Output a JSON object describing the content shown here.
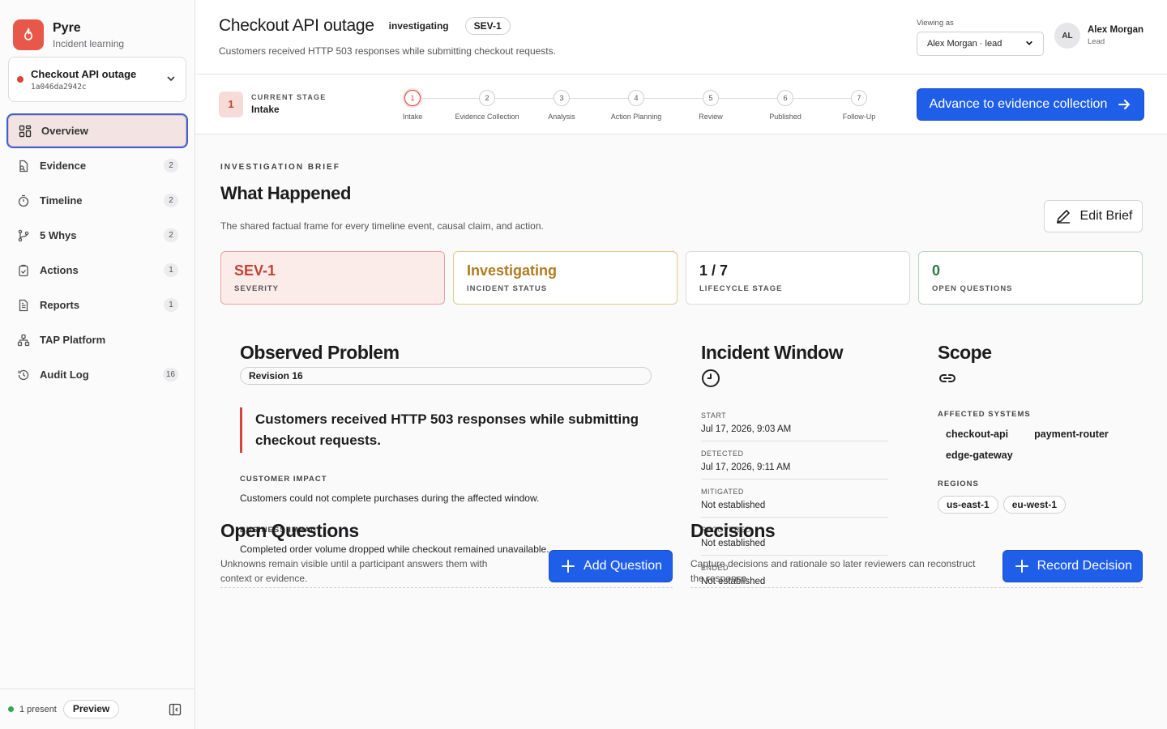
{
  "brand": {
    "name": "Pyre",
    "subtitle": "Incident learning"
  },
  "incident_picker": {
    "title": "Checkout API outage",
    "id": "1a046da2942c"
  },
  "nav": [
    {
      "label": "Overview",
      "count": "",
      "icon": "grid-icon",
      "active": true
    },
    {
      "label": "Evidence",
      "count": "2",
      "icon": "evidence-icon"
    },
    {
      "label": "Timeline",
      "count": "2",
      "icon": "timer-icon"
    },
    {
      "label": "5 Whys",
      "count": "2",
      "icon": "branch-icon"
    },
    {
      "label": "Actions",
      "count": "1",
      "icon": "clipboard-check-icon"
    },
    {
      "label": "Reports",
      "count": "1",
      "icon": "document-icon"
    },
    {
      "label": "TAP Platform",
      "count": "",
      "icon": "network-icon"
    },
    {
      "label": "Audit Log",
      "count": "16",
      "icon": "history-icon"
    }
  ],
  "footer": {
    "presence": "1 present",
    "preview": "Preview"
  },
  "header": {
    "title": "Checkout API outage",
    "status": "investigating",
    "severity": "SEV-1",
    "subtitle": "Customers received HTTP 503 responses while submitting checkout requests.",
    "viewing_label": "Viewing as",
    "viewing_value": "Alex Morgan · lead",
    "user_initials": "AL",
    "user_name": "Alex Morgan",
    "user_role": "Lead"
  },
  "stage": {
    "number": "1",
    "label": "CURRENT STAGE",
    "value": "Intake",
    "steps": [
      {
        "n": "1",
        "name": "Intake"
      },
      {
        "n": "2",
        "name": "Evidence Collection"
      },
      {
        "n": "3",
        "name": "Analysis"
      },
      {
        "n": "4",
        "name": "Action Planning"
      },
      {
        "n": "5",
        "name": "Review"
      },
      {
        "n": "6",
        "name": "Published"
      },
      {
        "n": "7",
        "name": "Follow-Up"
      }
    ],
    "advance_label": "Advance to evidence collection"
  },
  "brief": {
    "eyebrow": "INVESTIGATION BRIEF",
    "title": "What Happened",
    "subtitle": "The shared factual frame for every timeline event, causal claim, and action.",
    "edit_label": "Edit Brief"
  },
  "stats": [
    {
      "value": "SEV-1",
      "label": "SEVERITY"
    },
    {
      "value": "Investigating",
      "label": "INCIDENT STATUS"
    },
    {
      "value": "1 / 7",
      "label": "LIFECYCLE STAGE"
    },
    {
      "value": "0",
      "label": "OPEN QUESTIONS"
    }
  ],
  "observed": {
    "title": "Observed Problem",
    "revision": "Revision 16",
    "quote": "Customers received HTTP 503 responses while submitting checkout requests.",
    "customer_impact_label": "CUSTOMER IMPACT",
    "customer_impact": "Customers could not complete purchases during the affected window.",
    "business_impact_label": "BUSINESS IMPACT",
    "business_impact": "Completed order volume dropped while checkout remained unavailable."
  },
  "window": {
    "title": "Incident Window",
    "rows": [
      {
        "label": "START",
        "value": "Jul 17, 2026, 9:03 AM"
      },
      {
        "label": "DETECTED",
        "value": "Jul 17, 2026, 9:11 AM"
      },
      {
        "label": "MITIGATED",
        "value": "Not established"
      },
      {
        "label": "RECOVERED",
        "value": "Not established"
      },
      {
        "label": "ENDED",
        "value": "Not established"
      }
    ]
  },
  "scope": {
    "title": "Scope",
    "systems_label": "AFFECTED SYSTEMS",
    "systems": [
      "checkout-api",
      "payment-router",
      "edge-gateway"
    ],
    "regions_label": "REGIONS",
    "regions": [
      "us-east-1",
      "eu-west-1"
    ]
  },
  "questions": {
    "title": "Open Questions",
    "subtitle": "Unknowns remain visible until a participant answers them with context or evidence.",
    "button": "Add Question"
  },
  "decisions": {
    "title": "Decisions",
    "subtitle": "Capture decisions and rationale so later reviewers can reconstruct the response.",
    "button": "Record Decision"
  },
  "colors": {
    "accent": "#1f5ee9",
    "brand": "#e8584a",
    "danger": "#c44133",
    "warning": "#b07a1f",
    "success": "#2c7a44"
  }
}
